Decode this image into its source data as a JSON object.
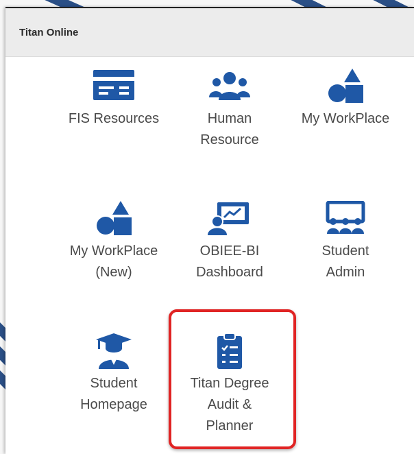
{
  "header": {
    "title": "Titan Online"
  },
  "tiles": [
    {
      "label": "FIS Resources",
      "icon": "credit-card-icon"
    },
    {
      "label": "Human\nResource",
      "icon": "people-group-icon"
    },
    {
      "label": "My WorkPlace",
      "icon": "shapes-icon"
    },
    {
      "label": "My WorkPlace\n(New)",
      "icon": "shapes-icon"
    },
    {
      "label": "OBIEE-BI\nDashboard",
      "icon": "presentation-chart-icon"
    },
    {
      "label": "Student\nAdmin",
      "icon": "classroom-icon"
    },
    {
      "label": "Student\nHomepage",
      "icon": "graduate-icon"
    },
    {
      "label": "Titan Degree\nAudit &\nPlanner",
      "icon": "clipboard-checklist-icon"
    }
  ],
  "colors": {
    "icon_blue": "#1f58a6",
    "highlight_red": "#e02424",
    "header_bg": "#ececec"
  }
}
